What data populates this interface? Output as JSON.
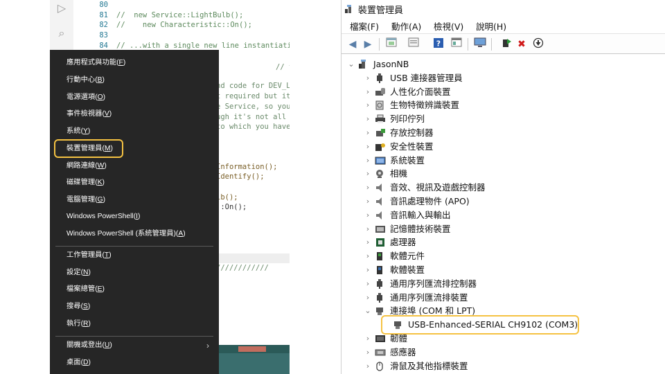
{
  "editor": {
    "line_numbers": [
      "80",
      "81",
      "82",
      "83",
      "84"
    ],
    "lines": [
      "",
      "//  new Service::LightBulb();",
      "//    new Characteristic::On();",
      "",
      "// ...with a single new line instantiating"
    ],
    "fragments": [
      "// this instanti",
      "nd code for DEV_LE",
      "t required but it'",
      "e Service, so you",
      "ugh it's not all",
      "to which you have",
      "Information();",
      "Identify();",
      "lb();",
      "::On();",
      "////////////"
    ]
  },
  "winx_menu": {
    "items": [
      {
        "label": "應用程式與功能",
        "accel": "F"
      },
      {
        "label": "行動中心",
        "accel": "B"
      },
      {
        "label": "電源選項",
        "accel": "O"
      },
      {
        "label": "事件檢視器",
        "accel": "V"
      },
      {
        "label": "系統",
        "accel": "Y"
      },
      {
        "label": "裝置管理員",
        "accel": "M"
      },
      {
        "label": "網路連線",
        "accel": "W"
      },
      {
        "label": "磁碟管理",
        "accel": "K"
      },
      {
        "label": "電腦管理",
        "accel": "G"
      },
      {
        "label": "Windows PowerShell",
        "accel": "I"
      },
      {
        "label": "Windows PowerShell (系統管理員)",
        "accel": "A"
      },
      {
        "label": "工作管理員",
        "accel": "T"
      },
      {
        "label": "設定",
        "accel": "N"
      },
      {
        "label": "檔案總管",
        "accel": "E"
      },
      {
        "label": "搜尋",
        "accel": "S"
      },
      {
        "label": "執行",
        "accel": "R"
      },
      {
        "label": "關機或登出",
        "accel": "U"
      },
      {
        "label": "桌面",
        "accel": "D"
      }
    ],
    "highlighted_item": "裝置管理員(M)",
    "highlight_color": "#f5c242"
  },
  "device_manager": {
    "title": "裝置管理員",
    "menu": [
      "檔案(F)",
      "動作(A)",
      "檢視(V)",
      "說明(H)"
    ],
    "toolbar_icons": [
      "back-arrow-icon",
      "forward-arrow-icon",
      "properties-icon",
      "show-hidden-icon",
      "help-icon",
      "view-icon",
      "monitor-icon",
      "update-driver-icon",
      "uninstall-icon",
      "scan-hardware-icon"
    ],
    "root": "JasonNB",
    "categories": [
      "USB 連接器管理員",
      "人性化介面裝置",
      "生物特徵辨識裝置",
      "列印佇列",
      "存放控制器",
      "安全性裝置",
      "系統裝置",
      "相機",
      "音效、視訊及遊戲控制器",
      "音訊處理物件 (APO)",
      "音訊輸入與輸出",
      "記憶體技術裝置",
      "處理器",
      "軟體元件",
      "軟體裝置",
      "通用序列匯流排控制器",
      "通用序列匯流排裝置",
      "連接埠 (COM 和 LPT)",
      "韌體",
      "感應器",
      "滑鼠及其他指標裝置"
    ],
    "expanded_category": "連接埠 (COM 和 LPT)",
    "child_device": "USB-Enhanced-SERIAL CH9102 (COM3)",
    "highlight_color": "#f5c242"
  }
}
